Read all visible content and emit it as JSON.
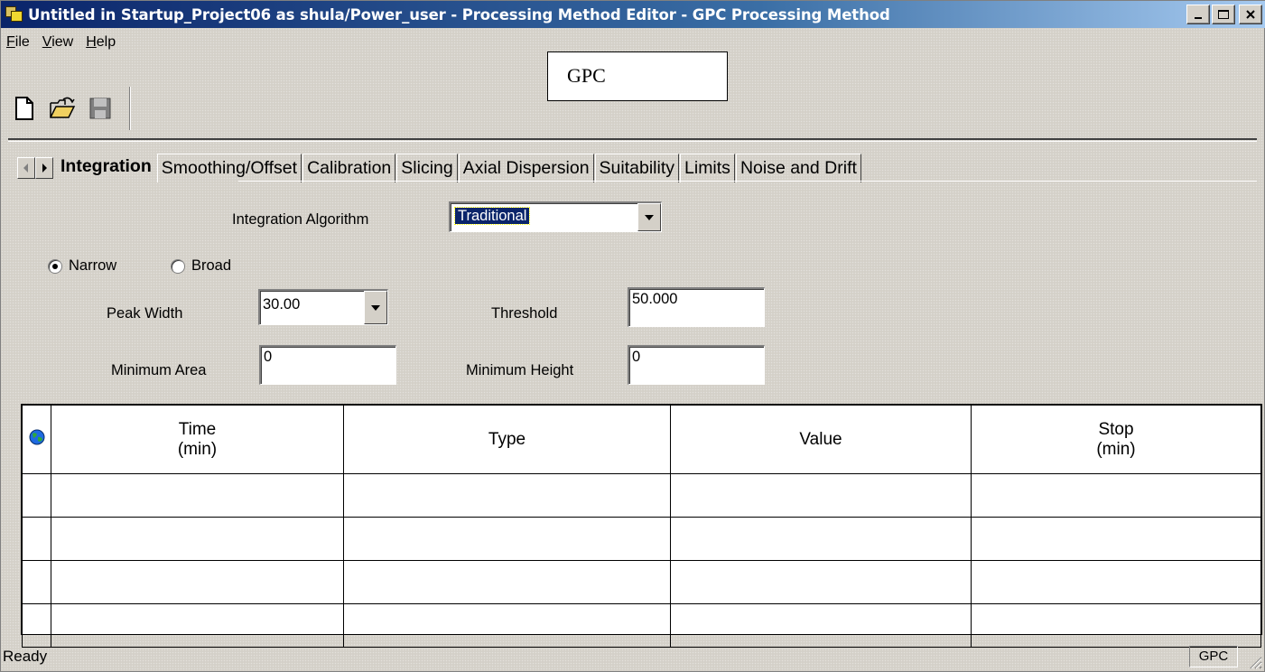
{
  "window": {
    "title": "Untitled in Startup_Project06 as shula/Power_user - Processing Method Editor - GPC Processing Method",
    "minimize_label": "_",
    "maximize_label": "□",
    "close_label": "✕"
  },
  "menu": {
    "items": [
      "File",
      "View",
      "Help"
    ]
  },
  "annotation": {
    "text": "GPC"
  },
  "toolbar": {
    "icons": [
      "new-document-icon",
      "open-folder-icon",
      "save-icon"
    ]
  },
  "tabs": {
    "items": [
      "Integration",
      "Smoothing/Offset",
      "Calibration",
      "Slicing",
      "Axial Dispersion",
      "Suitability",
      "Limits",
      "Noise and Drift"
    ],
    "active": "Integration"
  },
  "integration": {
    "algorithm_label": "Integration Algorithm",
    "algorithm_value": "Traditional",
    "narrow_label": "Narrow",
    "broad_label": "Broad",
    "selected_mode": "Narrow",
    "peak_width_label": "Peak Width",
    "peak_width_value": "30.00",
    "threshold_label": "Threshold",
    "threshold_value": "50.000",
    "min_area_label": "Minimum Area",
    "min_area_value": "0",
    "min_height_label": "Minimum Height",
    "min_height_value": "0"
  },
  "events_table": {
    "header_icon": "globe-icon",
    "columns": [
      {
        "line1": "Time",
        "line2": "(min)"
      },
      {
        "line1": "Type",
        "line2": ""
      },
      {
        "line1": "Value",
        "line2": ""
      },
      {
        "line1": "Stop",
        "line2": "(min)"
      }
    ],
    "row_count": 4
  },
  "status": {
    "text": "Ready",
    "pane": "GPC"
  }
}
